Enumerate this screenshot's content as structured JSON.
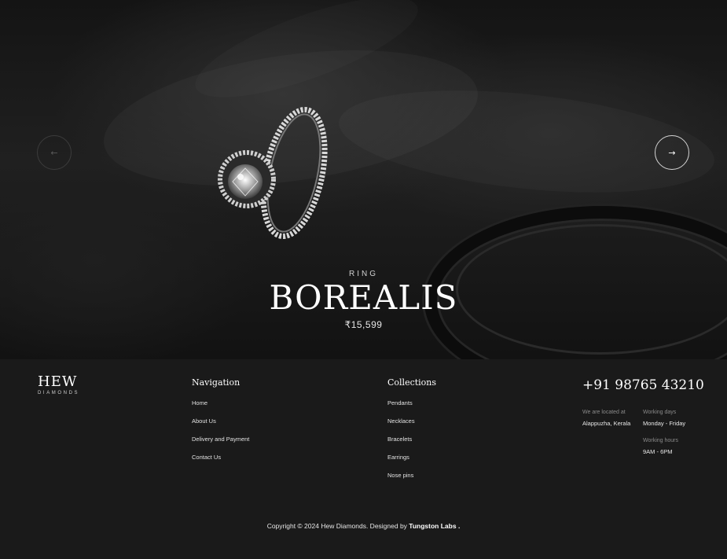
{
  "hero": {
    "category": "RING",
    "name": "BOREALIS",
    "price": "₹15,599",
    "prev_icon": "arrow-left-icon",
    "next_icon": "arrow-right-icon",
    "prev_glyph": "←",
    "next_glyph": "→"
  },
  "brand": {
    "name": "HEW",
    "tagline": "DIAMONDS"
  },
  "navigation": {
    "heading": "Navigation",
    "items": [
      "Home",
      "About Us",
      "Delivery and Payment",
      "Contact Us"
    ]
  },
  "collections": {
    "heading": "Collections",
    "items": [
      "Pendants",
      "Necklaces",
      "Bracelets",
      "Earrings",
      "Nose pins"
    ]
  },
  "contact": {
    "phone": "+91 98765 43210",
    "location_label": "We are located at",
    "location_value": "Alappuzha, Kerala",
    "days_label": "Working days",
    "days_value": "Monday - Friday",
    "hours_label": "Working hours",
    "hours_value": "9AM - 6PM"
  },
  "footer": {
    "copyright_prefix": "Copyright © 2024 Hew Diamonds. Designed by ",
    "designer": "Tungston Labs ."
  },
  "colors": {
    "background": "#1a1a1a",
    "text": "#ffffff",
    "muted": "#8a8a8a"
  }
}
